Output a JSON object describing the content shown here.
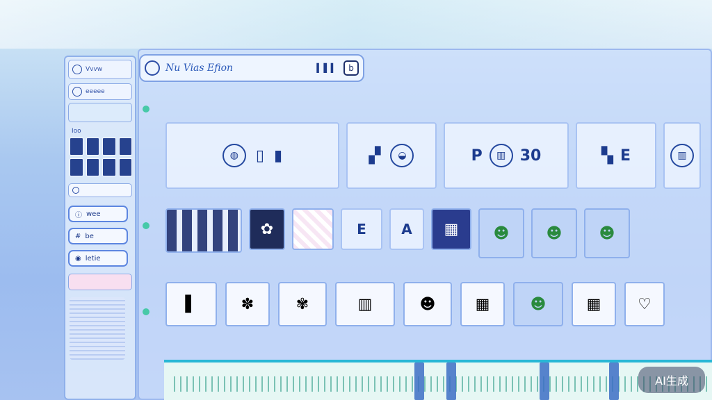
{
  "app": {
    "title": "Nu Vias Efion"
  },
  "sidebar": {
    "header_label": "Vvvw",
    "profile_label": "eeeee",
    "section_label": "Ioo",
    "pills": [
      {
        "icon": "info-icon",
        "label": "wee"
      },
      {
        "icon": "hash-icon",
        "label": "be"
      },
      {
        "icon": "user-icon",
        "label": "letie"
      }
    ]
  },
  "toolbar": {
    "code_label": "b"
  },
  "rows": {
    "top": [
      "P",
      "30",
      "E"
    ],
    "mid": [
      "E",
      "A"
    ]
  },
  "badge": {
    "label": "AI生成"
  },
  "colors": {
    "accent": "#2b59b9",
    "timeline": "#28b7d6",
    "green": "#47c9a8"
  }
}
